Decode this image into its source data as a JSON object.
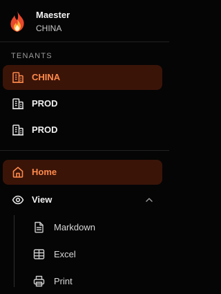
{
  "app": {
    "name": "Maester",
    "current_tenant": "CHINA"
  },
  "tenants": {
    "section_label": "TENANTS",
    "items": [
      {
        "label": "CHINA",
        "active": true,
        "icon": "building-icon"
      },
      {
        "label": "PROD",
        "active": false,
        "icon": "building-icon"
      },
      {
        "label": "PROD",
        "active": false,
        "icon": "building-icon"
      }
    ]
  },
  "nav": {
    "home": {
      "label": "Home",
      "active": true,
      "icon": "home-icon"
    },
    "view": {
      "label": "View",
      "expanded": true,
      "icon": "eye-icon",
      "children": [
        {
          "label": "Markdown",
          "icon": "file-text-icon"
        },
        {
          "label": "Excel",
          "icon": "table-icon"
        },
        {
          "label": "Print",
          "icon": "printer-icon"
        }
      ]
    }
  },
  "colors": {
    "accent": "#ff8a4c",
    "active_bg": "#3b1408",
    "background": "#050505"
  }
}
